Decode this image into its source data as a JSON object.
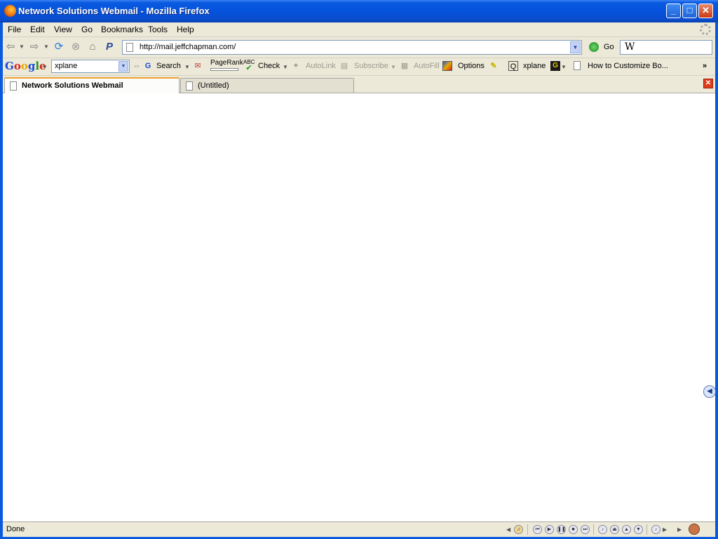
{
  "window": {
    "title": "Network Solutions Webmail - Mozilla Firefox"
  },
  "menu": [
    "File",
    "Edit",
    "View",
    "Go",
    "Bookmarks",
    "Tools",
    "Help"
  ],
  "nav": {
    "url": "http://mail.jeffchapman.com/",
    "go_label": "Go",
    "search_engine_glyph": "W"
  },
  "google_toolbar": {
    "logo": "Google",
    "search_value": "xplane",
    "search_label": "Search",
    "pagerank_label": "PageRank",
    "check_label": "Check",
    "abc_label": "ABC",
    "autolink_label": "AutoLink",
    "subscribe_label": "Subscribe",
    "autofill_label": "AutoFill",
    "options_label": "Options",
    "xplane_label": "xplane",
    "bookmark_label": "How to Customize Bo...",
    "overflow_label": "»"
  },
  "tabs": [
    {
      "label": "Network Solutions Webmail",
      "active": true
    },
    {
      "label": "(Untitled)",
      "active": false
    }
  ],
  "status": {
    "text": "Done"
  }
}
